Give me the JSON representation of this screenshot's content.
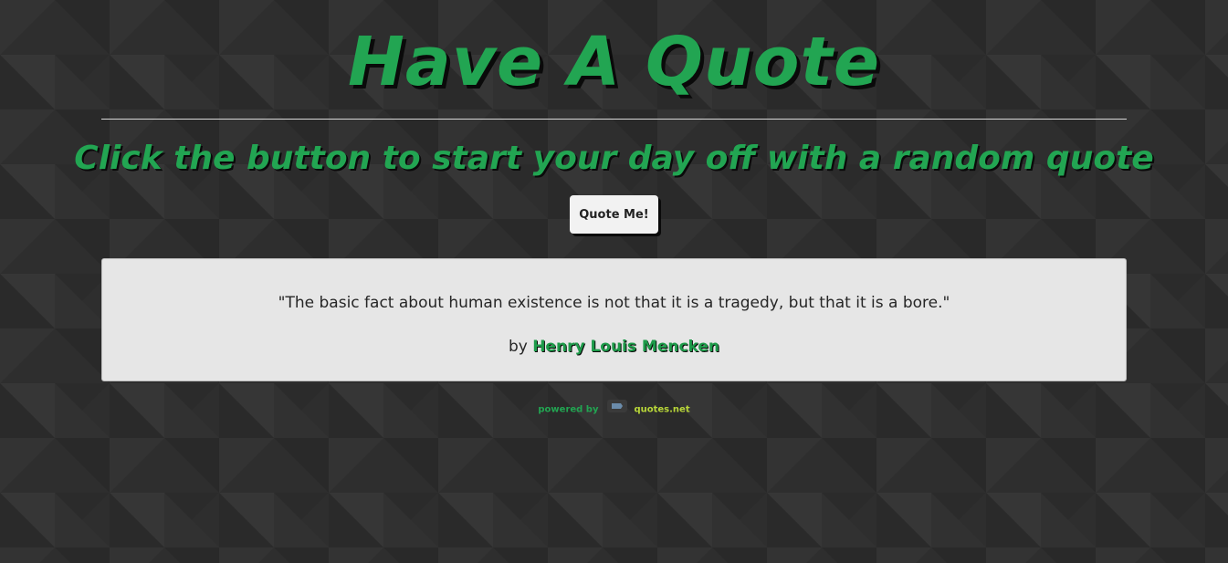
{
  "header": {
    "title": "Have A Quote",
    "subtitle": "Click the button to start your day off with a random quote"
  },
  "actions": {
    "quote_button_label": "Quote Me!"
  },
  "quote": {
    "text": "\"The basic fact about human existence is not that it is a tragedy, but that it is a bore.\"",
    "by_label": "by",
    "author": "Henry Louis Mencken"
  },
  "footer": {
    "powered_by_label": "powered by",
    "source_name": "quotes.net"
  },
  "colors": {
    "background": "#2e2e2e",
    "accent_green": "#22a552",
    "quote_box": "#e6e6e6",
    "button": "#f2f2f2",
    "link_lime": "#b8d639"
  },
  "icons": {
    "source_logo": "quotes-net-logo-icon"
  }
}
